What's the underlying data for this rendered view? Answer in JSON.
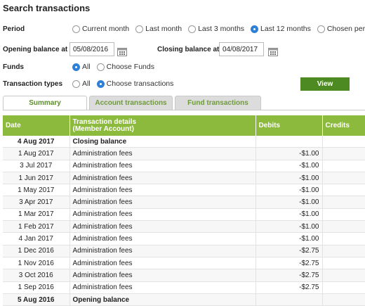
{
  "title": "Search transactions",
  "period": {
    "label": "Period",
    "options": [
      "Current month",
      "Last month",
      "Last 3 months",
      "Last 12 months",
      "Chosen period"
    ],
    "selected": 3
  },
  "balances": {
    "opening_label": "Opening balance at",
    "opening_value": "05/08/2016",
    "closing_label": "Closing balance at",
    "closing_value": "04/08/2017"
  },
  "funds": {
    "label": "Funds",
    "options": [
      "All",
      "Choose Funds"
    ],
    "selected": 0
  },
  "transaction_types": {
    "label": "Transaction types",
    "options": [
      "All",
      "Choose transactions"
    ],
    "selected": 1
  },
  "view_label": "View",
  "tabs": [
    "Summary",
    "Account transactions",
    "Fund transactions"
  ],
  "active_tab": 0,
  "table": {
    "headers": [
      "Date",
      "Transaction details\n(Member Account)",
      "Debits",
      "Credits"
    ],
    "rows": [
      {
        "date": "4 Aug 2017",
        "details": "Closing balance",
        "debit": "",
        "credit": "",
        "bold": true
      },
      {
        "date": "1 Aug 2017",
        "details": "Administration fees",
        "debit": "-$1.00",
        "credit": ""
      },
      {
        "date": "3 Jul 2017",
        "details": "Administration fees",
        "debit": "-$1.00",
        "credit": ""
      },
      {
        "date": "1 Jun 2017",
        "details": "Administration fees",
        "debit": "-$1.00",
        "credit": ""
      },
      {
        "date": "1 May 2017",
        "details": "Administration fees",
        "debit": "-$1.00",
        "credit": ""
      },
      {
        "date": "3 Apr 2017",
        "details": "Administration fees",
        "debit": "-$1.00",
        "credit": ""
      },
      {
        "date": "1 Mar 2017",
        "details": "Administration fees",
        "debit": "-$1.00",
        "credit": ""
      },
      {
        "date": "1 Feb 2017",
        "details": "Administration fees",
        "debit": "-$1.00",
        "credit": ""
      },
      {
        "date": "4 Jan 2017",
        "details": "Administration fees",
        "debit": "-$1.00",
        "credit": ""
      },
      {
        "date": "1 Dec 2016",
        "details": "Administration fees",
        "debit": "-$2.75",
        "credit": ""
      },
      {
        "date": "1 Nov 2016",
        "details": "Administration fees",
        "debit": "-$2.75",
        "credit": ""
      },
      {
        "date": "3 Oct 2016",
        "details": "Administration fees",
        "debit": "-$2.75",
        "credit": ""
      },
      {
        "date": "1 Sep 2016",
        "details": "Administration fees",
        "debit": "-$2.75",
        "credit": ""
      },
      {
        "date": "5 Aug 2016",
        "details": "Opening balance",
        "debit": "",
        "credit": "",
        "bold": true
      }
    ]
  },
  "colors": {
    "header_green": "#8cba3c",
    "button_green": "#4e8a22",
    "radio_blue": "#2f7fd6",
    "tab_text": "#6f9a3a"
  }
}
